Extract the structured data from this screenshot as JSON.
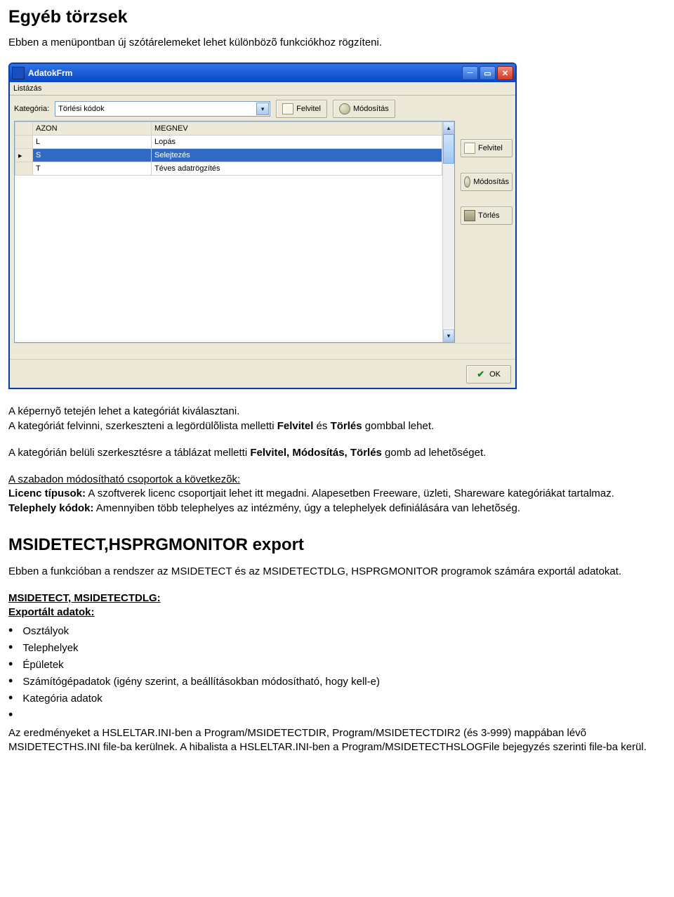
{
  "doc": {
    "h1": "Egyéb törzsek",
    "p1": "Ebben a menüpontban új szótárelemeket lehet különbözõ funkciókhoz rögzíteni.",
    "p2_a": "A képernyõ tetején lehet a kategóriát kiválasztani.",
    "p2_b": "A kategóriát felvinni, szerkeszteni a legördülõlista melletti ",
    "p2_fvitel": "Felvitel",
    "p2_c": " és ",
    "p2_torles": "Törlés",
    "p2_d": " gombbal lehet.",
    "p3_a": "A kategórián belüli szerkesztésre a táblázat melletti ",
    "p3_fm": "Felvitel, Módosítás, Törlés",
    "p3_b": " gomb ad lehetõséget.",
    "p4_head": "A szabadon módosítható csoportok a következõk:",
    "p4_lic_l": "Licenc típusok:",
    "p4_lic_t": " A szoftverek licenc csoportjait lehet itt megadni. Alapesetben Freeware, üzleti, Shareware kategóriákat tartalmaz.",
    "p4_tel_l": "Telephely kódok:",
    "p4_tel_t": " Amennyiben több telephelyes az intézmény, úgy a telephelyek definiálására van lehetõség.",
    "h2": "MSIDETECT,HSPRGMONITOR export",
    "p5": "Ebben a funkcióban a rendszer az MSIDETECT és az MSIDETECTDLG, HSPRGMONITOR programok számára exportál adatokat.",
    "sec_msidetect": "MSIDETECT, MSIDETECTDLG:",
    "sec_exp": "Exportált adatok:",
    "bullets": [
      "Osztályok",
      "Telephelyek",
      "Épületek",
      "Számítógépadatok (igény szerint, a beállításokban módosítható, hogy kell-e)",
      "Kategória adatok"
    ],
    "p6": "Az eredményeket a HSLELTAR.INI-ben a Program/MSIDETECTDIR, Program/MSIDETECTDIR2 (és 3-999)  mappában lévõ MSIDETECTHS.INI file-ba kerülnek. A hibalista a HSLELTAR.INI-ben a Program/MSIDETECTHSLOGFile bejegyzés szerinti file-ba kerül."
  },
  "win": {
    "title": "AdatokFrm",
    "menu": {
      "listazas": "Listázás"
    },
    "kategoria_label": "Kategória:",
    "combo_value": "Törlési kódok",
    "btn_felvitel": "Felvitel",
    "btn_modositas": "Módosítás",
    "col_azon": "AZON",
    "col_megnev": "MEGNEV",
    "rows": [
      {
        "code": "L",
        "name": "Lopás"
      },
      {
        "code": "S",
        "name": "Selejtezés"
      },
      {
        "code": "T",
        "name": "Téves adatrögzítés"
      }
    ],
    "side_felvitel": "Felvitel",
    "side_modositas": "Módosítás",
    "side_torles": "Törlés",
    "ok": "OK"
  }
}
